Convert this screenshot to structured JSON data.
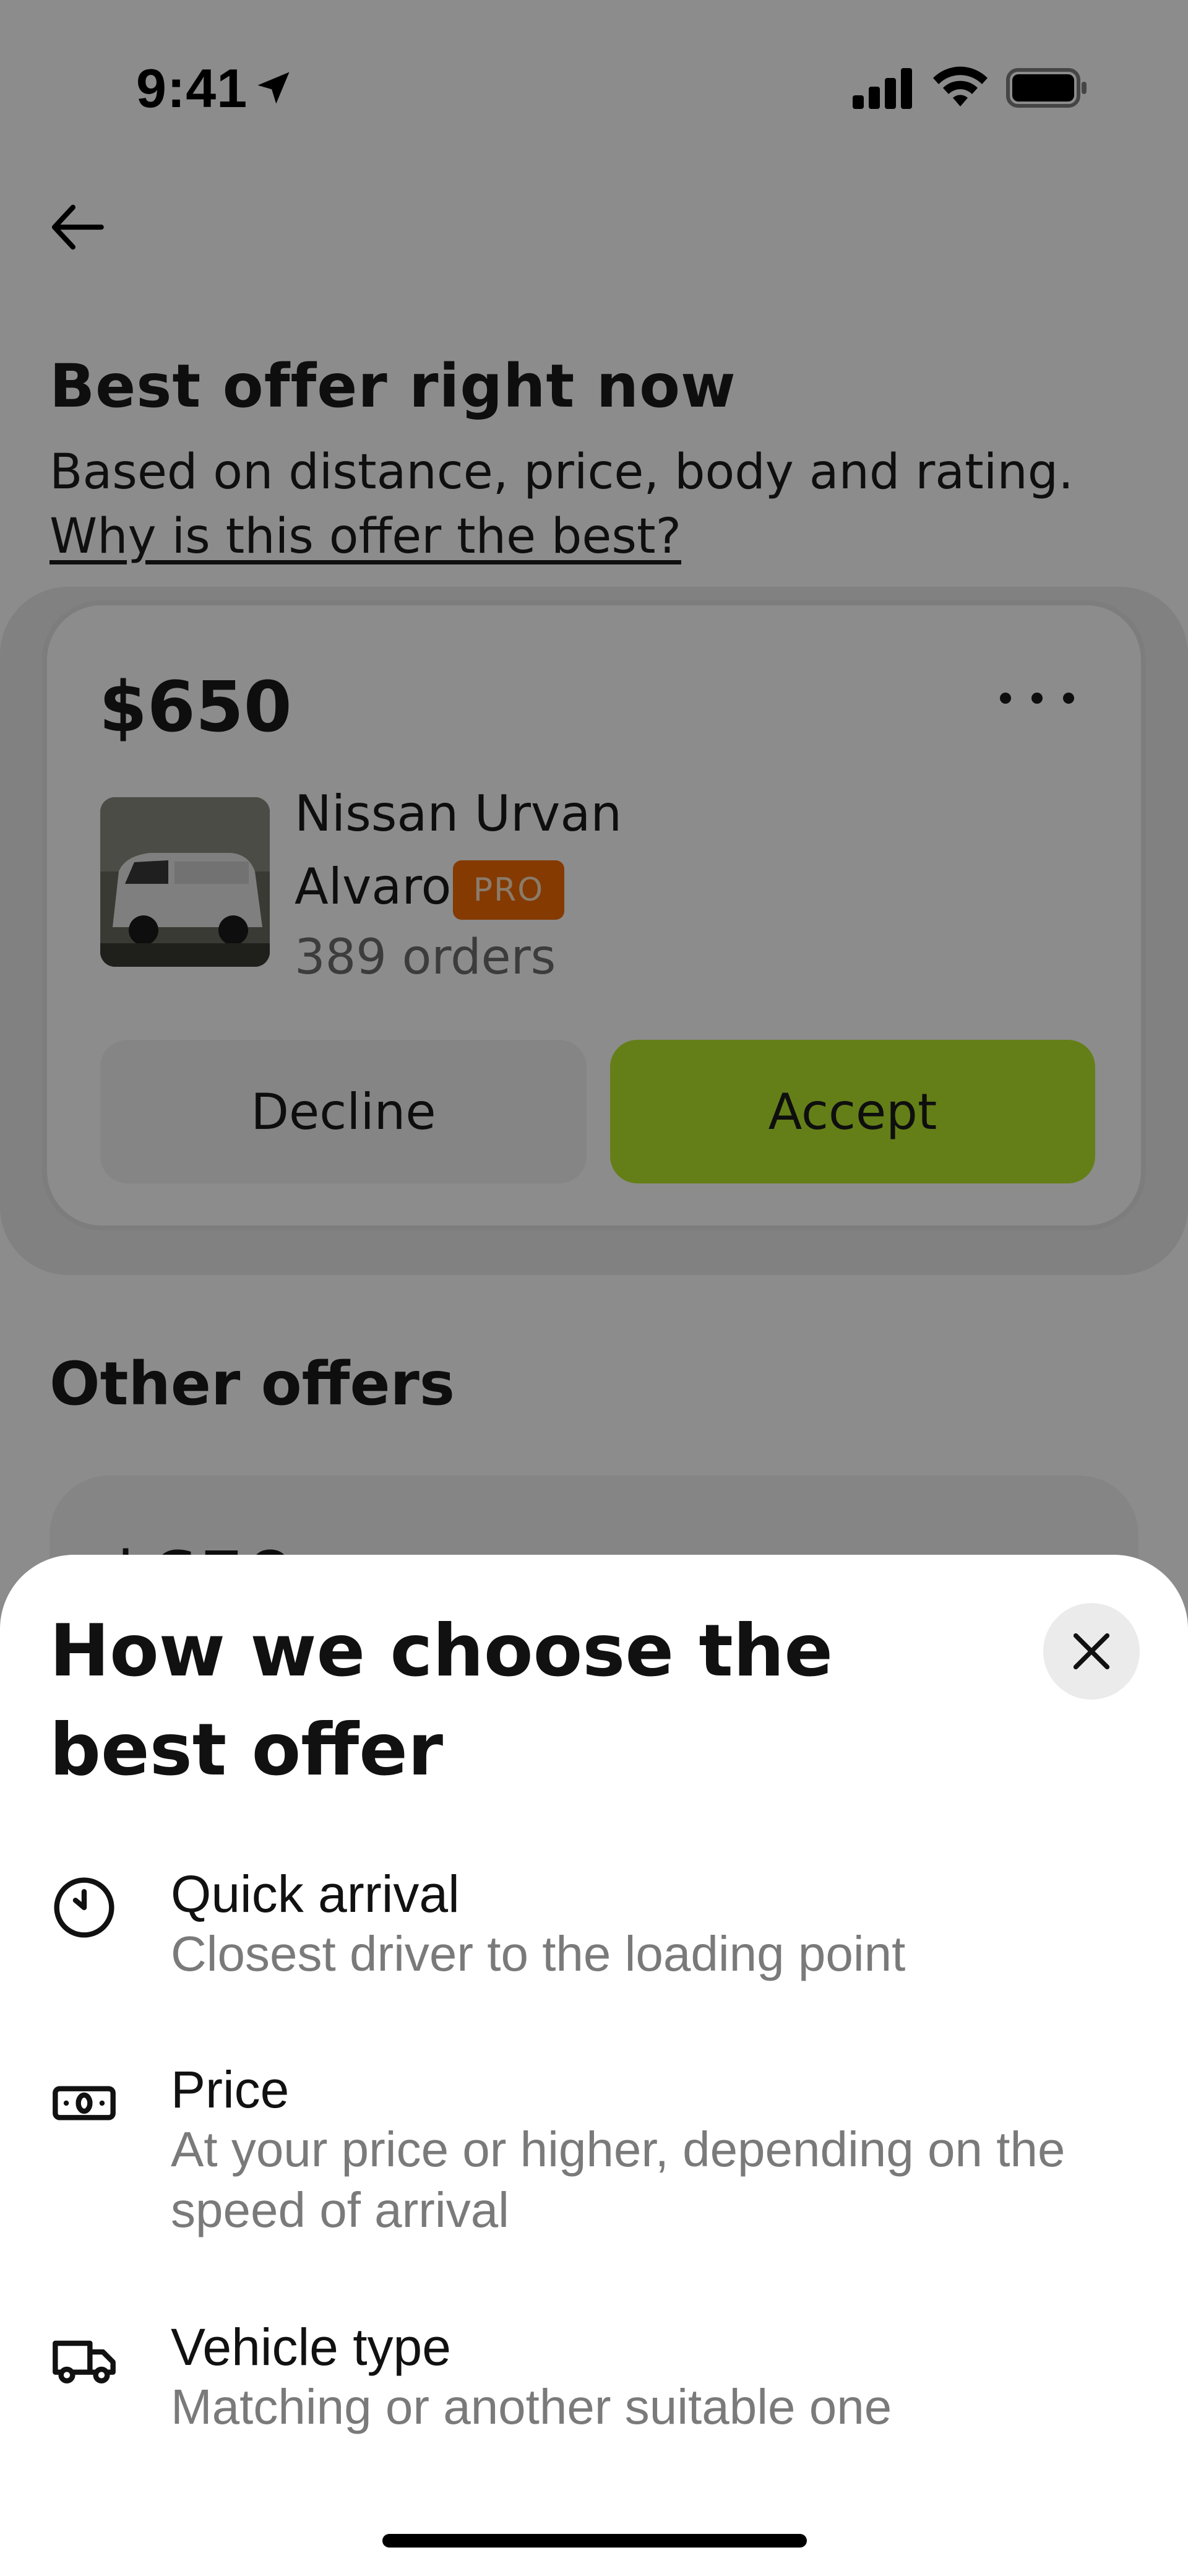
{
  "status_bar": {
    "time": "9:41",
    "icons": [
      "location-arrow-icon",
      "cellular-signal-icon",
      "wifi-icon",
      "battery-icon"
    ]
  },
  "header": {
    "back_icon": "arrow-left-icon"
  },
  "best_offer": {
    "title": "Best offer right now",
    "subtitle": "Based on distance, price, body and rating.",
    "why_link": "Why is this offer the best?",
    "card": {
      "price": "$650",
      "more_icon": "more-horizontal-icon",
      "vehicle": "Nissan Urvan",
      "driver": "Alvaro",
      "badge": "PRO",
      "orders": "389 orders",
      "decline_label": "Decline",
      "accept_label": "Accept"
    }
  },
  "other_offers": {
    "title": "Other offers",
    "first_price": "$650"
  },
  "sheet": {
    "title": "How we choose the best offer",
    "close_icon": "close-icon",
    "criteria": [
      {
        "icon": "clock-icon",
        "title": "Quick arrival",
        "description": "Closest driver to the loading point"
      },
      {
        "icon": "banknote-icon",
        "title": "Price",
        "description": "At your price or higher, depending on the speed of arrival"
      },
      {
        "icon": "truck-icon",
        "title": "Vehicle type",
        "description": "Matching or another suitable one"
      }
    ]
  },
  "colors": {
    "accept": "#b7e82c",
    "pro_badge": "#f06a00",
    "overlay": "rgba(0,0,0,0.45)"
  }
}
